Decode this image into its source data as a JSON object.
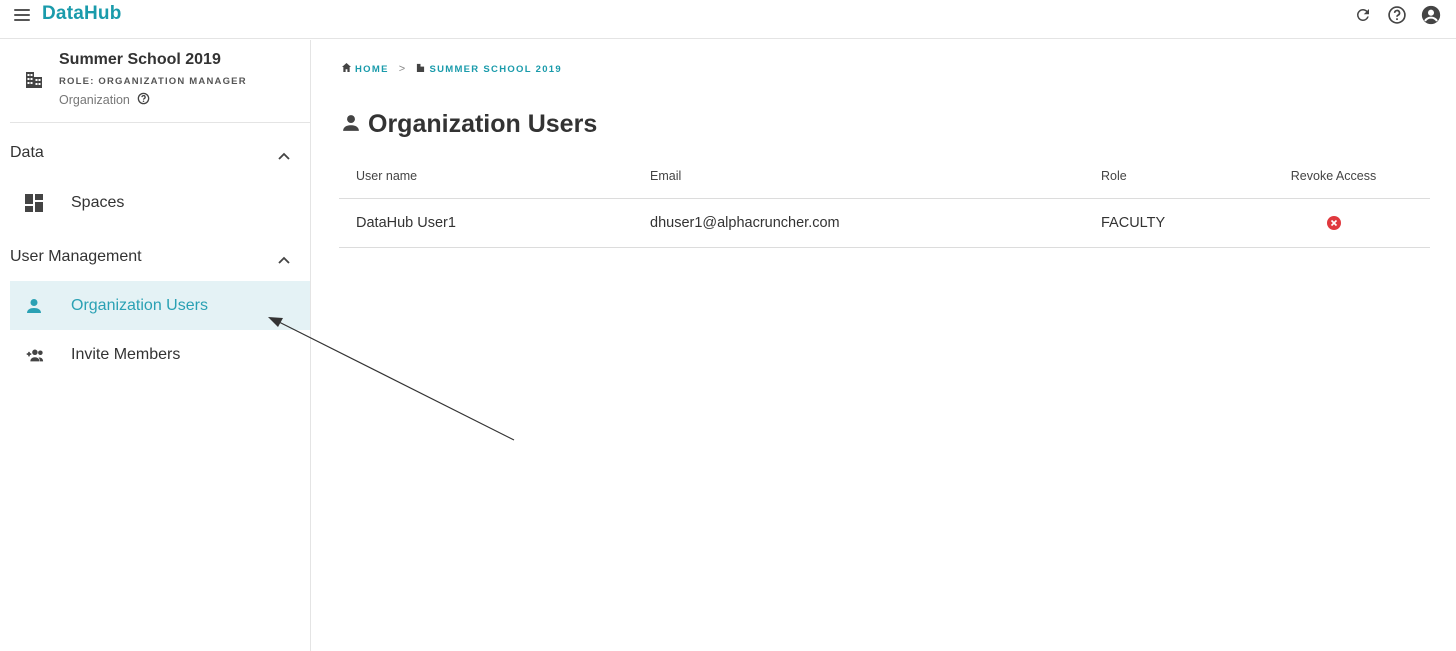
{
  "app": {
    "brand": "DataHub",
    "accent_color": "#1a9bab",
    "top_icons": [
      "refresh-icon",
      "help-icon",
      "account-icon"
    ]
  },
  "sidebar": {
    "org": {
      "name": "Summer School 2019",
      "role": "ROLE: ORGANIZATION MANAGER",
      "type": "Organization"
    },
    "sections": [
      {
        "label": "Data",
        "items": [
          {
            "label": "Spaces",
            "icon": "dashboard-icon"
          }
        ]
      },
      {
        "label": "User Management",
        "items": [
          {
            "label": "Organization Users",
            "icon": "person-icon",
            "active": true
          },
          {
            "label": "Invite Members",
            "icon": "group-add-icon"
          }
        ]
      }
    ]
  },
  "main": {
    "breadcrumb": [
      {
        "label": "HOME",
        "icon": "home-icon"
      },
      {
        "label": "SUMMER SCHOOL 2019",
        "icon": "building-icon"
      }
    ],
    "breadcrumb_separator": ">",
    "title": "Organization Users",
    "table": {
      "headers": [
        "User name",
        "Email",
        "Role",
        "Revoke Access"
      ],
      "rows": [
        {
          "user": "DataHub User1",
          "email": "dhuser1@alphacruncher.com",
          "role": "FACULTY"
        }
      ]
    }
  }
}
